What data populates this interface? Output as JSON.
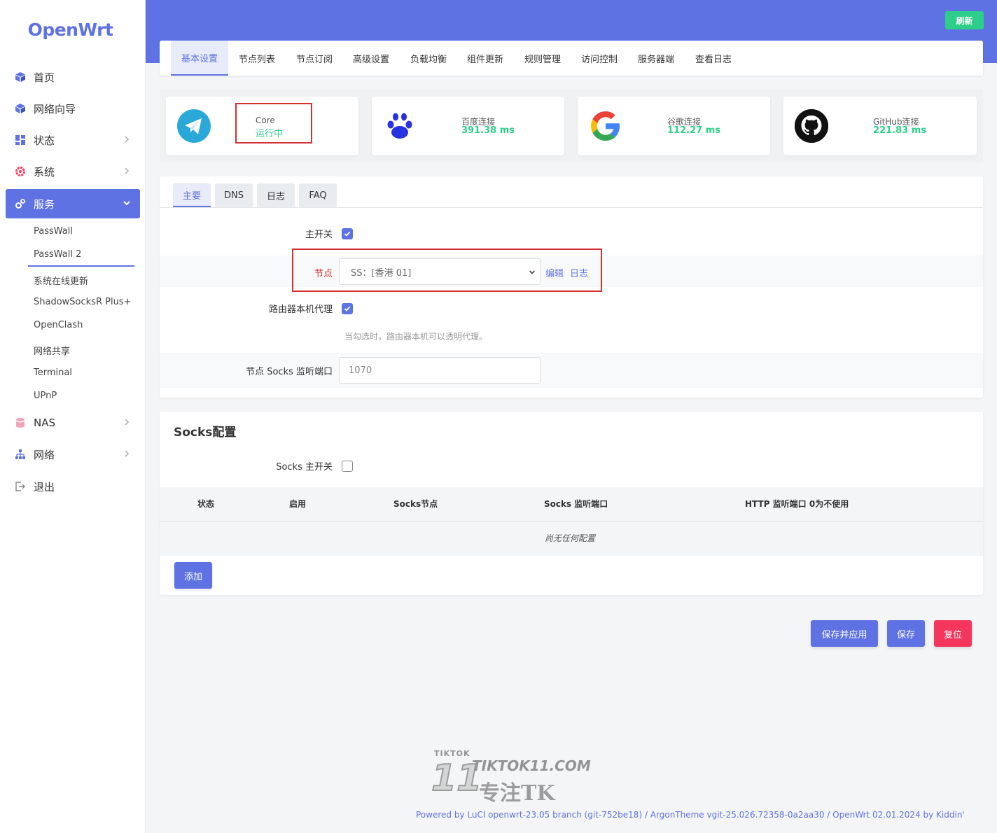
{
  "brand": "OpenWrt",
  "sidebar": {
    "items": [
      {
        "label": "首页",
        "icon": "cube-icon"
      },
      {
        "label": "网络向导",
        "icon": "cube-icon"
      },
      {
        "label": "状态",
        "icon": "grid-icon"
      },
      {
        "label": "系统",
        "icon": "gear-icon"
      },
      {
        "label": "服务",
        "icon": "services-icon"
      },
      {
        "label": "NAS",
        "icon": "database-icon"
      },
      {
        "label": "网络",
        "icon": "network-icon"
      },
      {
        "label": "退出",
        "icon": "logout-icon"
      }
    ],
    "services_sub": [
      "PassWall",
      "PassWall 2",
      "系统在线更新",
      "ShadowSocksR Plus+",
      "OpenClash",
      "网络共享",
      "Terminal",
      "UPnP"
    ]
  },
  "header": {
    "refresh": "刷新"
  },
  "top_tabs": [
    "基本设置",
    "节点列表",
    "节点订阅",
    "高级设置",
    "负载均衡",
    "组件更新",
    "规则管理",
    "访问控制",
    "服务器端",
    "查看日志"
  ],
  "status_cards": {
    "core": {
      "label": "Core",
      "value": "运行中"
    },
    "baidu": {
      "label": "百度连接",
      "value": "391.38 ms"
    },
    "google": {
      "label": "谷歌连接",
      "value": "112.27 ms"
    },
    "github": {
      "label": "GitHub连接",
      "value": "221.83 ms"
    }
  },
  "sub_tabs": [
    "主要",
    "DNS",
    "日志",
    "FAQ"
  ],
  "form": {
    "main_switch": {
      "label": "主开关",
      "checked": true
    },
    "node": {
      "label": "节点",
      "value": "SS：[香港 01]",
      "edit": "编辑",
      "log": "日志"
    },
    "router_proxy": {
      "label": "路由器本机代理",
      "checked": true,
      "hint": "当勾选时，路由器本机可以透明代理。"
    },
    "socks_port": {
      "label": "节点 Socks 监听端口",
      "placeholder": "1070"
    }
  },
  "socks": {
    "title": "Socks配置",
    "switch": {
      "label": "Socks 主开关",
      "checked": false
    },
    "columns": [
      "状态",
      "启用",
      "Socks节点",
      "Socks 监听端口",
      "HTTP 监听端口 0为不使用"
    ],
    "empty": "尚无任何配置",
    "add": "添加"
  },
  "actions": {
    "save_apply": "保存并应用",
    "save": "保存",
    "reset": "复位"
  },
  "watermark": {
    "small": "TIKTOK",
    "num": "11",
    "site": "TIKTOK11.COM",
    "cn": "专注TK"
  },
  "footer": "Powered by LuCI openwrt-23.05 branch (git-752be18) / ArgonTheme vgit-25.026.72358-0a2aa30 / OpenWrt 02.01.2024 by Kiddin'",
  "colors": {
    "accent": "#5e72e4",
    "success": "#2dce89",
    "danger": "#f5365c",
    "highlight_box": "#d32f2f"
  }
}
